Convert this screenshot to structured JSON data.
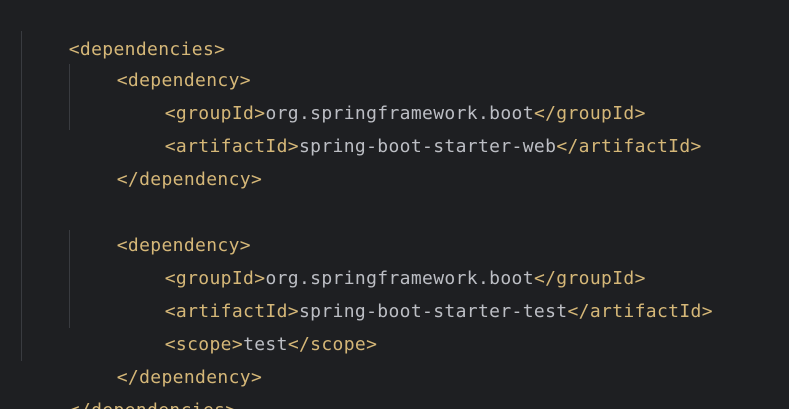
{
  "code_editor": {
    "language": "XML (Maven pom.xml)",
    "colors": {
      "background": "#1e1f22",
      "tag": "#d5b778",
      "text": "#bcbec4",
      "indent_guide": "#393b40"
    },
    "lines": [
      {
        "open": "<dependencies>",
        "text": "",
        "close": ""
      },
      {
        "open": "<dependency>",
        "text": "",
        "close": ""
      },
      {
        "open": "<groupId>",
        "text": "org.springframework.boot",
        "close": "</groupId>"
      },
      {
        "open": "<artifactId>",
        "text": "spring-boot-starter-web",
        "close": "</artifactId>"
      },
      {
        "open": "</dependency>",
        "text": "",
        "close": ""
      },
      {
        "open": "",
        "text": "",
        "close": ""
      },
      {
        "open": "<dependency>",
        "text": "",
        "close": ""
      },
      {
        "open": "<groupId>",
        "text": "org.springframework.boot",
        "close": "</groupId>"
      },
      {
        "open": "<artifactId>",
        "text": "spring-boot-starter-test",
        "close": "</artifactId>"
      },
      {
        "open": "<scope>",
        "text": "test",
        "close": "</scope>"
      },
      {
        "open": "</dependency>",
        "text": "",
        "close": ""
      },
      {
        "open": "</dependencies>",
        "text": "",
        "close": ""
      }
    ]
  }
}
